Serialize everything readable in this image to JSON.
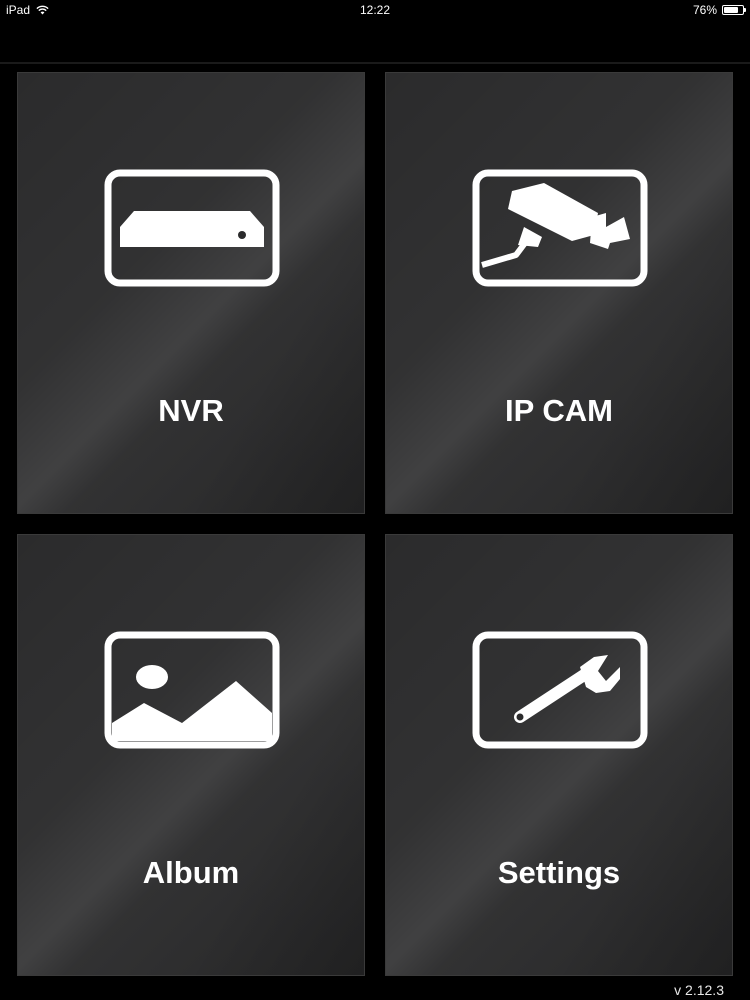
{
  "status_bar": {
    "device": "iPad",
    "time": "12:22",
    "battery_text": "76%",
    "battery_level": 0.76
  },
  "tiles": [
    {
      "label": "NVR",
      "icon": "nvr-recorder-icon"
    },
    {
      "label": "IP CAM",
      "icon": "security-camera-icon"
    },
    {
      "label": "Album",
      "icon": "photo-album-icon"
    },
    {
      "label": "Settings",
      "icon": "wrench-icon"
    }
  ],
  "footer": {
    "version": "v 2.12.3"
  },
  "colors": {
    "background": "#000000",
    "tile": "#2b2b2c",
    "foreground": "#ffffff"
  }
}
